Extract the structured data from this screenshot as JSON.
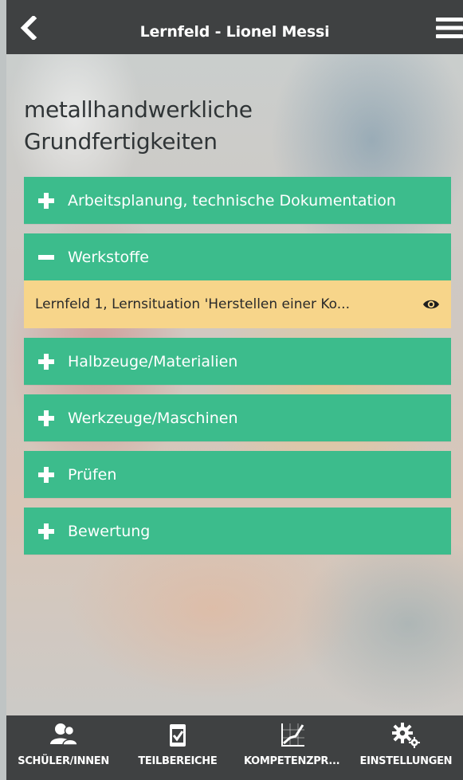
{
  "header": {
    "title": "Lernfeld - Lionel Messi",
    "back_icon": "chevron-left-icon",
    "menu_icon": "hamburger-menu-icon"
  },
  "page": {
    "title_line1": "metallhandwerkliche",
    "title_line2": "Grundfertigkeiten"
  },
  "categories": [
    {
      "label": "Arbeitsplanung, technische Dokumentation",
      "icon": "plus-icon",
      "expanded": false
    },
    {
      "label": "Werkstoffe",
      "icon": "minus-icon",
      "expanded": true,
      "children": [
        {
          "label": "Lernfeld 1, Lernsituation 'Herstellen einer Ko...",
          "icon": "eye-icon"
        }
      ]
    },
    {
      "label": "Halbzeuge/Materialien",
      "icon": "plus-icon",
      "expanded": false
    },
    {
      "label": "Werkzeuge/Maschinen",
      "icon": "plus-icon",
      "expanded": false
    },
    {
      "label": "Prüfen",
      "icon": "plus-icon",
      "expanded": false
    },
    {
      "label": "Bewertung",
      "icon": "plus-icon",
      "expanded": false
    }
  ],
  "tabbar": [
    {
      "label": "SCHÜLER/INNEN",
      "icon": "users-icon"
    },
    {
      "label": "TEILBEREICHE",
      "icon": "checklist-icon"
    },
    {
      "label": "KOMPETENZPR...",
      "icon": "chart-icon"
    },
    {
      "label": "EINSTELLUNGEN",
      "icon": "gears-icon"
    }
  ],
  "colors": {
    "header_bg": "#3f4142",
    "category_bg": "#3cbc8c",
    "subitem_bg": "#f7d58a",
    "tabbar_bg": "#3f4142"
  }
}
